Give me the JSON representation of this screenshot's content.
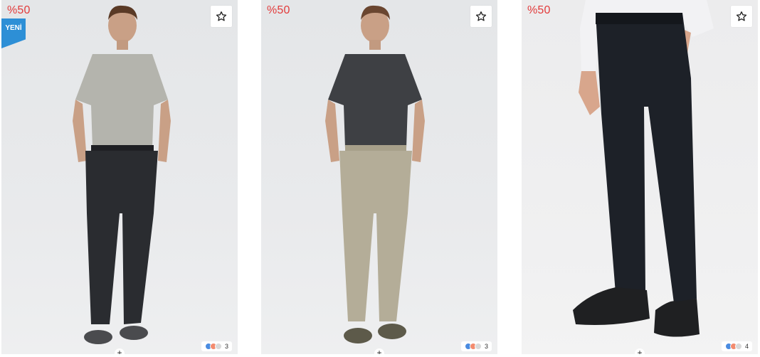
{
  "products": [
    {
      "discount": "%50",
      "badge": "YENİ",
      "colors_count": "3",
      "add_symbol": "+",
      "pants_color": "#2a2c30",
      "shirt_color": "#b4b4ad"
    },
    {
      "discount": "%50",
      "colors_count": "3",
      "add_symbol": "+",
      "pants_color": "#b4ad98",
      "shirt_color": "#3e4044"
    },
    {
      "discount": "%50",
      "colors_count": "4",
      "add_symbol": "+",
      "pants_color": "#1d2128",
      "shirt_color": "#f2f2f4"
    }
  ],
  "swatch_colors": [
    "#4a8be0",
    "#f28b6e",
    "#d9d9d9"
  ]
}
